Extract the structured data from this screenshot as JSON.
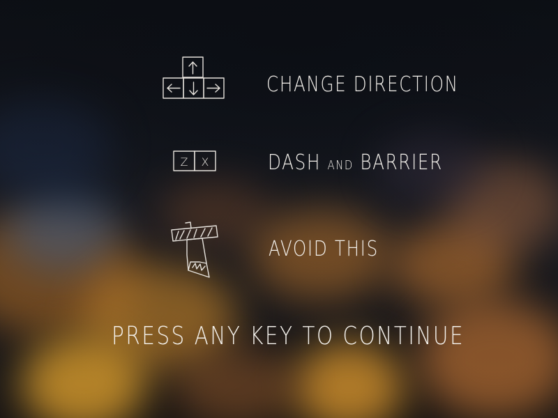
{
  "instructions": [
    {
      "icon": "arrow-keys-icon",
      "label_parts": [
        {
          "text": "CHANGE DIRECTION",
          "size": "big"
        }
      ]
    },
    {
      "icon": "zx-keys-icon",
      "label_parts": [
        {
          "text": "DASH ",
          "size": "big"
        },
        {
          "text": "AND",
          "size": "small"
        },
        {
          "text": " BARRIER",
          "size": "big"
        }
      ]
    },
    {
      "icon": "taped-hazard-icon",
      "label_parts": [
        {
          "text": "AVOID THIS",
          "size": "big"
        }
      ]
    }
  ],
  "keys": {
    "z": "Z",
    "x": "X"
  },
  "prompt": "PRESS ANY KEY TO CONTINUE",
  "colors": {
    "text": "#f4f1ec",
    "background": "#14161c",
    "bokeh_orange": "#f0a020",
    "bokeh_blue": "#2a4a7a"
  }
}
